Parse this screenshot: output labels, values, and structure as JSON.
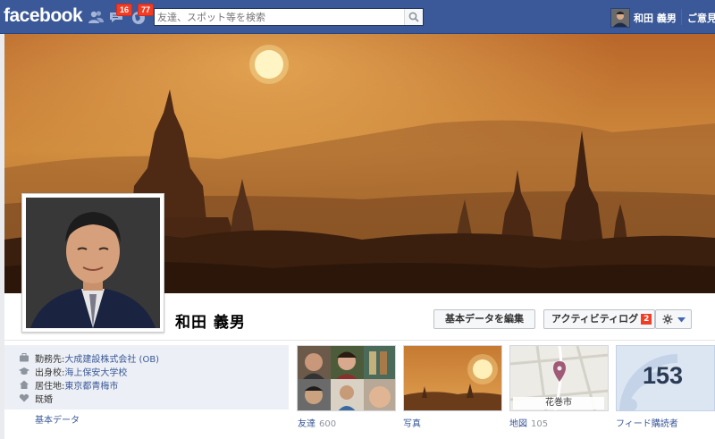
{
  "topbar": {
    "logo": "facebook",
    "friend_requests_icon": "friends-icon",
    "messages_badge": "16",
    "notifications_badge": "77",
    "search_placeholder": "友達、スポット等を検索",
    "user_name": "和田 義男",
    "home_link": "ご意見"
  },
  "profile": {
    "name": "和田 義男",
    "edit_button": "基本データを編集",
    "activity_button": "アクティビティログ",
    "activity_badge": "2",
    "settings_icon": "gear-icon"
  },
  "about": {
    "work_label": "勤務先:",
    "work_value": "大成建設株式会社 (OB)",
    "school_label": "出身校:",
    "school_value": "海上保安大学校",
    "residence_label": "居住地:",
    "residence_value": "東京都青梅市",
    "relationship": "既婚",
    "link": "基本データ"
  },
  "thumbs": {
    "friends_label": "友達",
    "friends_count": "600",
    "photos_label": "写真",
    "map_label": "地図",
    "map_count": "105",
    "map_city": "花巻市",
    "subscribers_label": "フィード購読者",
    "subscribers_count": "153"
  },
  "colors": {
    "brand": "#3b5998",
    "badge": "#f03d25",
    "cover_sky": "#c8782a"
  }
}
